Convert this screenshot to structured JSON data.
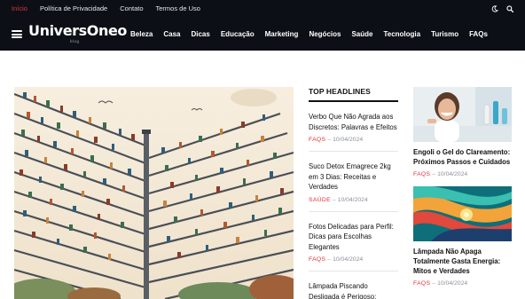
{
  "topbar": {
    "links": [
      {
        "label": "Início",
        "active": true
      },
      {
        "label": "Política de Privacidade",
        "active": false
      },
      {
        "label": "Contato",
        "active": false
      },
      {
        "label": "Termos de Uso",
        "active": false
      }
    ],
    "icons": [
      "moon-icon",
      "search-icon"
    ]
  },
  "navbar": {
    "logo_text": "UniversOneo",
    "logo_tagline": "blog",
    "menu": [
      "Beleza",
      "Casa",
      "Dicas",
      "Educação",
      "Marketing",
      "Negócios",
      "Saúde",
      "Tecnologia",
      "Turismo",
      "FAQs"
    ]
  },
  "headlines": {
    "title": "TOP HEADLINES",
    "items": [
      {
        "title": "Verbo Que Não Agrada aos Discretos: Palavras e Efeitos",
        "category": "FAQS",
        "date": "10/04/2024"
      },
      {
        "title": "Suco Detox Emagrece 2kg em 3 Dias: Receitas e Verdades",
        "category": "SAÚDE",
        "date": "10/04/2024"
      },
      {
        "title": "Fotos Delicadas para Perfil: Dicas para Escolhas Elegantes",
        "category": "FAQS",
        "date": "10/04/2024"
      },
      {
        "title": "Lâmpada Piscando Desligada é Perigoso:",
        "category": "",
        "date": ""
      }
    ]
  },
  "cards": [
    {
      "title": "Engoli o Gel do Clareamento: Próximos Passos e Cuidados",
      "category": "FAQS",
      "date": "10/04/2024"
    },
    {
      "title": "Lâmpada Não Apaga Totalmente Gasta Energia: Mitos e Verdades",
      "category": "FAQS",
      "date": "10/04/2024"
    }
  ],
  "meta_separator": "–",
  "colors": {
    "topbar_bg": "#0c1016",
    "accent": "#e0313c",
    "text": "#111111",
    "muted": "#8a9098"
  }
}
